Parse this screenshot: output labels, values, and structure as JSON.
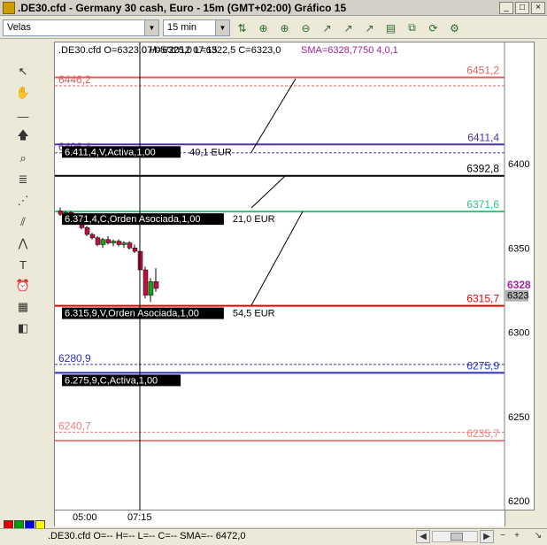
{
  "window": {
    "title": ".DE30.cfd - Germany 30 cash, Euro - 15m (GMT+02:00)  Gráfico 15",
    "min_label": "_",
    "max_label": "□",
    "close_label": "×"
  },
  "toolbar": {
    "chart_type_value": "Velas",
    "timeframe_value": "15 min"
  },
  "chart": {
    "header_text": ".DE30.cfd O=6323,0 H=6325,0 L=6322,5 C=6323,0",
    "overlay_date": "07/05/2012 07:15",
    "sma_text": "SMA=6328,7750  4,0,1",
    "price_axis": [
      "6400",
      "6350",
      "6300",
      "6250",
      "6200"
    ],
    "current_price": "6328",
    "bid_price": "6323",
    "time_axis": [
      "05:00",
      "07:15"
    ],
    "levels": [
      {
        "price": 6451.2,
        "label": "6451,2",
        "left_label": "6446,2",
        "color": "#e06060"
      },
      {
        "price": 6411.4,
        "label": "6411,4",
        "left_label": "6406,4",
        "color": "#5030a0"
      },
      {
        "price": 6392.8,
        "label": "6392,8",
        "left_label": "",
        "color": "#000000"
      },
      {
        "price": 6371.6,
        "label": "6371,6",
        "left_label": "",
        "color": "#30c080"
      },
      {
        "price": 6315.7,
        "label": "6315,7",
        "left_label": "",
        "color": "#e00000"
      },
      {
        "price": 6275.9,
        "label": "6275,9",
        "left_label": "6280,9",
        "color": "#3030c0"
      },
      {
        "price": 6235.7,
        "label": "6235,7",
        "left_label": "6240,7",
        "color": "#f08080"
      }
    ],
    "orders": [
      {
        "price": 6411.4,
        "label": "6.411,4,V,Activa,1,00",
        "pnl": "40,1 EUR"
      },
      {
        "price": 6371.6,
        "label": "6.371,4,C,Orden Asociada,1,00",
        "pnl": "21,0 EUR"
      },
      {
        "price": 6315.7,
        "label": "6.315,9,V,Orden Asociada,1,00",
        "pnl": "54,5 EUR"
      },
      {
        "price": 6275.9,
        "label": "6.275,9,C,Activa,1,00",
        "pnl": ""
      }
    ],
    "candles": [
      {
        "t": 0,
        "o": 6372,
        "h": 6374,
        "l": 6369,
        "c": 6370
      },
      {
        "t": 1,
        "o": 6370,
        "h": 6372,
        "l": 6368,
        "c": 6371
      },
      {
        "t": 2,
        "o": 6371,
        "h": 6372,
        "l": 6368,
        "c": 6369
      },
      {
        "t": 3,
        "o": 6369,
        "h": 6370,
        "l": 6365,
        "c": 6366
      },
      {
        "t": 4,
        "o": 6366,
        "h": 6367,
        "l": 6361,
        "c": 6362
      },
      {
        "t": 5,
        "o": 6362,
        "h": 6363,
        "l": 6357,
        "c": 6358
      },
      {
        "t": 6,
        "o": 6358,
        "h": 6359,
        "l": 6355,
        "c": 6356
      },
      {
        "t": 7,
        "o": 6356,
        "h": 6357,
        "l": 6351,
        "c": 6352
      },
      {
        "t": 8,
        "o": 6352,
        "h": 6356,
        "l": 6350,
        "c": 6355
      },
      {
        "t": 9,
        "o": 6355,
        "h": 6357,
        "l": 6352,
        "c": 6353
      },
      {
        "t": 10,
        "o": 6353,
        "h": 6355,
        "l": 6351,
        "c": 6354
      },
      {
        "t": 11,
        "o": 6354,
        "h": 6355,
        "l": 6351,
        "c": 6352
      },
      {
        "t": 12,
        "o": 6352,
        "h": 6354,
        "l": 6350,
        "c": 6353
      },
      {
        "t": 13,
        "o": 6353,
        "h": 6354,
        "l": 6349,
        "c": 6350
      },
      {
        "t": 14,
        "o": 6350,
        "h": 6352,
        "l": 6347,
        "c": 6348
      },
      {
        "t": 15,
        "o": 6348,
        "h": 6349,
        "l": 6335,
        "c": 6337
      },
      {
        "t": 16,
        "o": 6337,
        "h": 6339,
        "l": 6320,
        "c": 6322
      },
      {
        "t": 17,
        "o": 6322,
        "h": 6332,
        "l": 6318,
        "c": 6330
      },
      {
        "t": 18,
        "o": 6330,
        "h": 6338,
        "l": 6324,
        "c": 6326
      }
    ]
  },
  "status": {
    "text": ".DE30.cfd O=-- H=-- L=-- C=--   SMA=--    6472,0"
  }
}
